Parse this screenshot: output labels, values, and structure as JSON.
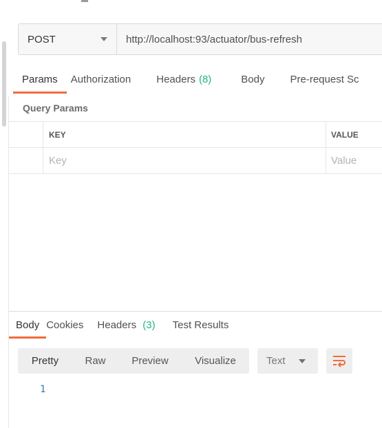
{
  "request": {
    "method": "POST",
    "url": "http://localhost:93/actuator/bus-refresh"
  },
  "request_tabs": [
    {
      "label": "Params",
      "count": "",
      "active": true
    },
    {
      "label": "Authorization",
      "count": "",
      "active": false
    },
    {
      "label": "Headers",
      "count": "(8)",
      "active": false
    },
    {
      "label": "Body",
      "count": "",
      "active": false
    },
    {
      "label": "Pre-request Sc",
      "count": "",
      "active": false
    }
  ],
  "query_params": {
    "title": "Query Params",
    "columns": [
      "KEY",
      "VALUE"
    ],
    "placeholders": {
      "key": "Key",
      "value": "Value"
    }
  },
  "response_tabs": [
    {
      "label": "Body",
      "count": "",
      "active": true
    },
    {
      "label": "Cookies",
      "count": "",
      "active": false
    },
    {
      "label": "Headers",
      "count": "(3)",
      "active": false
    },
    {
      "label": "Test Results",
      "count": "",
      "active": false
    }
  ],
  "response_view": {
    "options": [
      "Pretty",
      "Raw",
      "Preview",
      "Visualize"
    ],
    "selected": "Pretty",
    "format": "Text",
    "line_numbers": [
      "1"
    ]
  },
  "colors": {
    "accent": "#f26b3a",
    "count": "#26b47f",
    "line_number": "#2f7fa3"
  },
  "icons": {
    "method_dropdown": "chevron-down-icon",
    "format_dropdown": "chevron-down-icon",
    "wrap": "wrap-lines-icon"
  }
}
